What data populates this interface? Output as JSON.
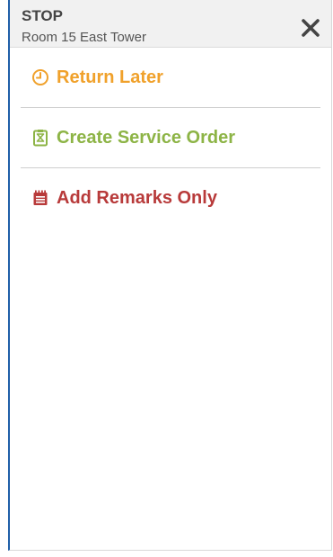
{
  "header": {
    "title": "STOP",
    "subtitle": "Room 15 East Tower"
  },
  "menu": {
    "items": [
      {
        "label": "Return Later",
        "icon": "clock-icon",
        "color": "#f0a12b"
      },
      {
        "label": "Create Service Order",
        "icon": "clipboard-hourglass-icon",
        "color": "#8db446"
      },
      {
        "label": "Add Remarks Only",
        "icon": "notepad-icon",
        "color": "#b83a3a"
      }
    ]
  },
  "colors": {
    "accent_border": "#1f5fa8",
    "header_bg": "#f1f1f1"
  }
}
